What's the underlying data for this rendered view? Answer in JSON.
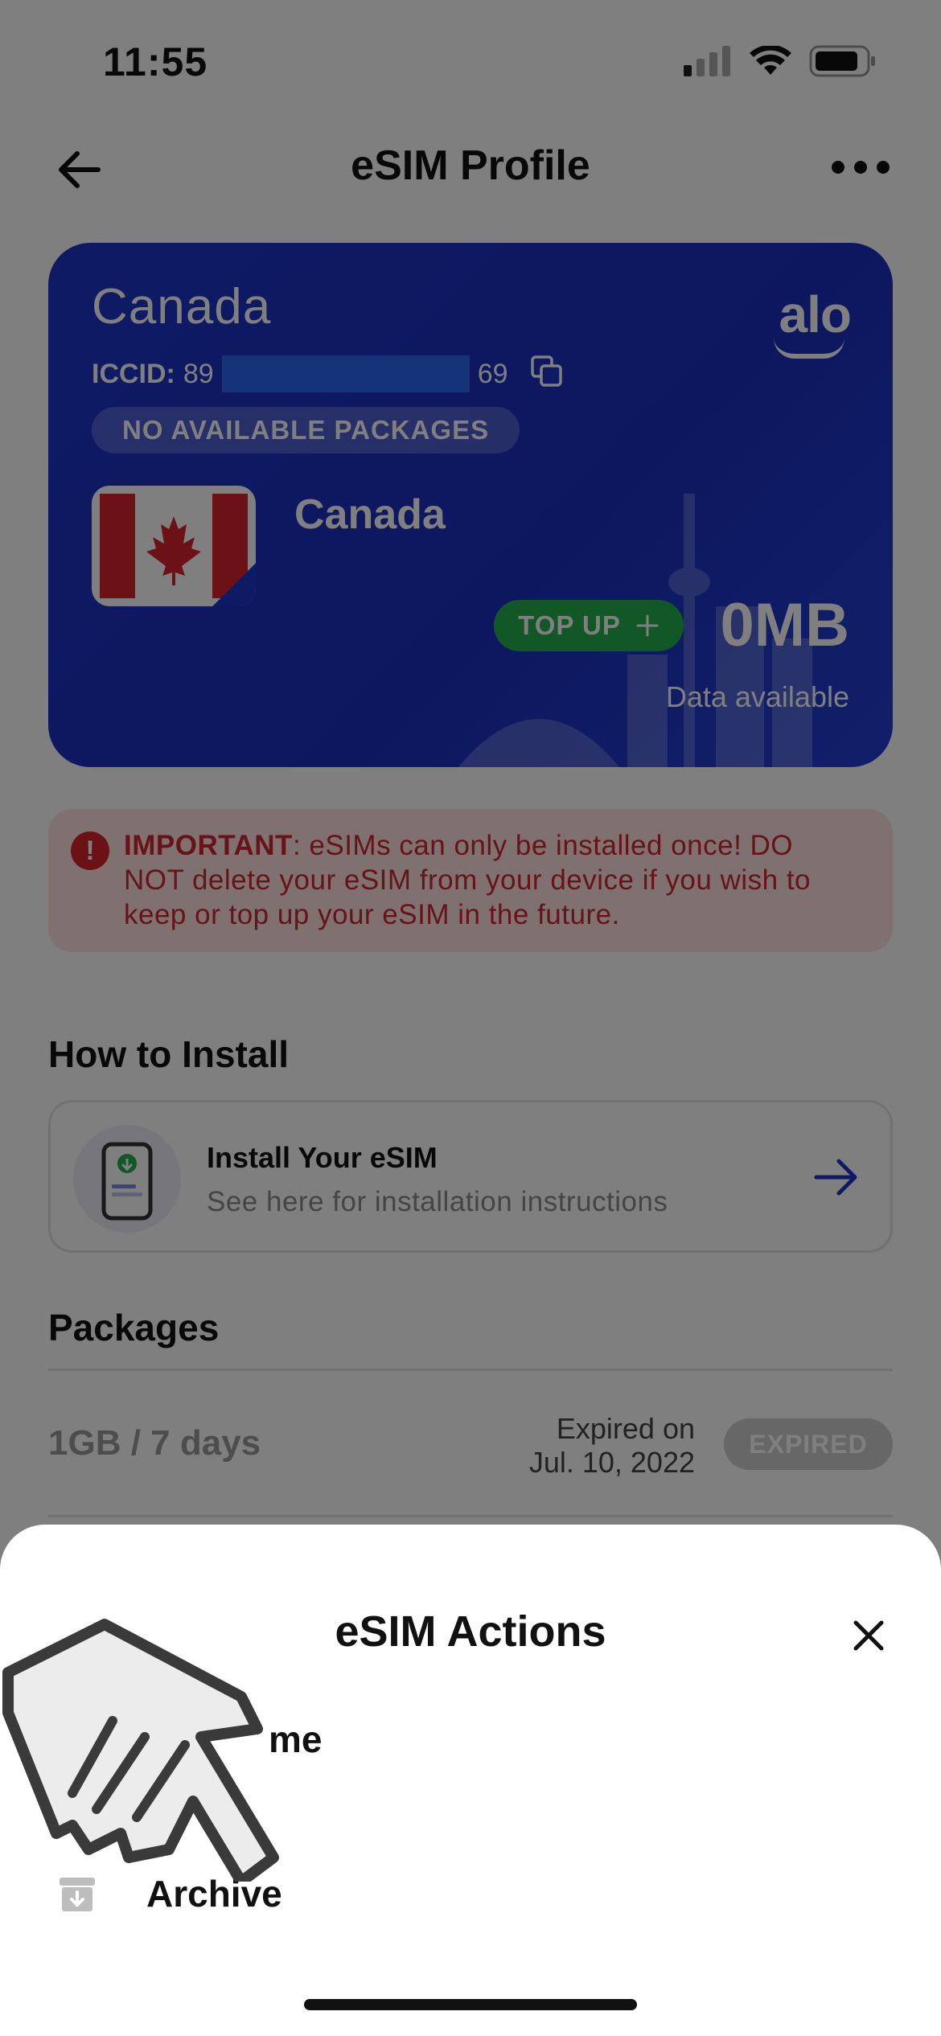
{
  "status_bar": {
    "time": "11:55"
  },
  "nav": {
    "title": "eSIM Profile"
  },
  "card": {
    "country": "Canada",
    "logo": "alo",
    "iccid_label": "ICCID:",
    "iccid_prefix": "89",
    "iccid_suffix": "69",
    "status_pill": "NO AVAILABLE PACKAGES",
    "plan_country": "Canada",
    "topup_label": "TOP UP",
    "data_amount": "0MB",
    "data_label": "Data available"
  },
  "warning": {
    "title": "IMPORTANT",
    "text": ": eSIMs can only be installed once! DO NOT delete your eSIM from your device if you wish to keep or top up your eSIM in the future."
  },
  "install": {
    "section_title": "How to Install",
    "title": "Install Your eSIM",
    "subtitle": "See here for installation instructions"
  },
  "packages": {
    "section_title": "Packages",
    "items": [
      {
        "name": "1GB / 7 days",
        "expired_line1": "Expired on",
        "expired_line2": "Jul. 10, 2022",
        "badge": "EXPIRED"
      }
    ]
  },
  "sheet": {
    "title": "eSIM Actions",
    "rename_label": "me",
    "archive_label": "Archive"
  },
  "colors": {
    "card_blue": "#1d35c9",
    "topup_green": "#22b14c",
    "warning_red": "#d12630",
    "accent_blue": "#1f35c8"
  }
}
